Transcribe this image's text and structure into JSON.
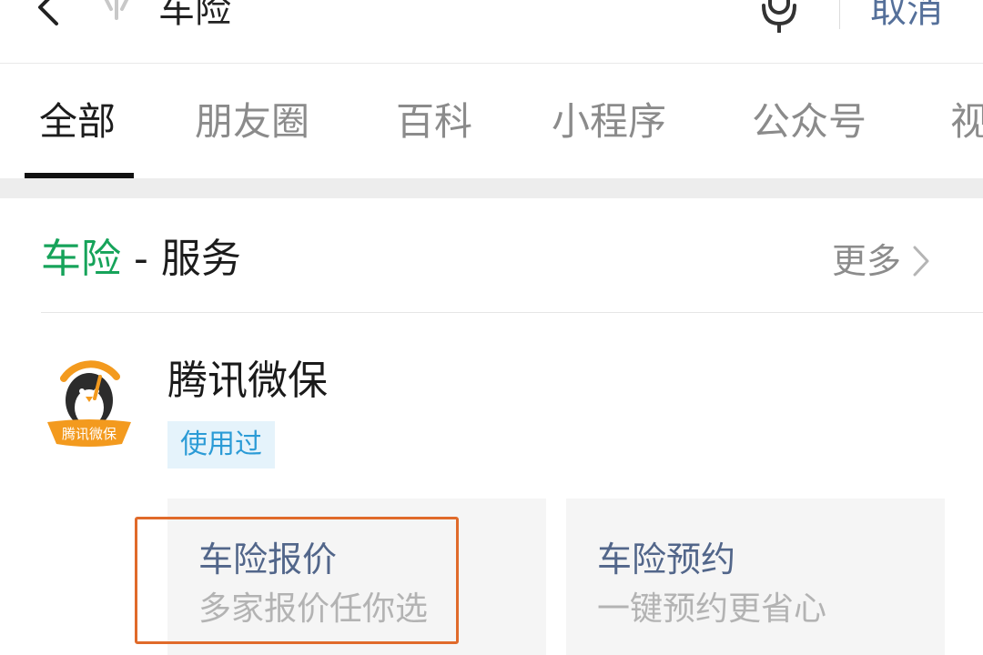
{
  "search": {
    "query": "车险",
    "cancel_label": "取消"
  },
  "tabs": [
    {
      "label": "全部",
      "active": true
    },
    {
      "label": "朋友圈",
      "active": false
    },
    {
      "label": "百科",
      "active": false
    },
    {
      "label": "小程序",
      "active": false
    },
    {
      "label": "公众号",
      "active": false
    },
    {
      "label": "视",
      "active": false
    }
  ],
  "service": {
    "keyword": "车险",
    "separator": " - ",
    "title_rest": "服务",
    "more_label": "更多"
  },
  "app": {
    "name": "腾讯微保",
    "logo_text": "腾讯微保",
    "badge": "使用过",
    "actions": [
      {
        "title": "车险报价",
        "subtitle": "多家报价任你选",
        "highlighted": true
      },
      {
        "title": "车险预约",
        "subtitle": "一键预约更省心",
        "highlighted": false
      }
    ]
  },
  "colors": {
    "keyword_green": "#16a35a",
    "link_blue": "#55709a",
    "badge_blue": "#2b9bd6",
    "highlight_orange": "#e06a2a"
  },
  "icons": [
    "back-arrow-icon",
    "sparkle-icon",
    "microphone-icon",
    "chevron-right-icon"
  ]
}
